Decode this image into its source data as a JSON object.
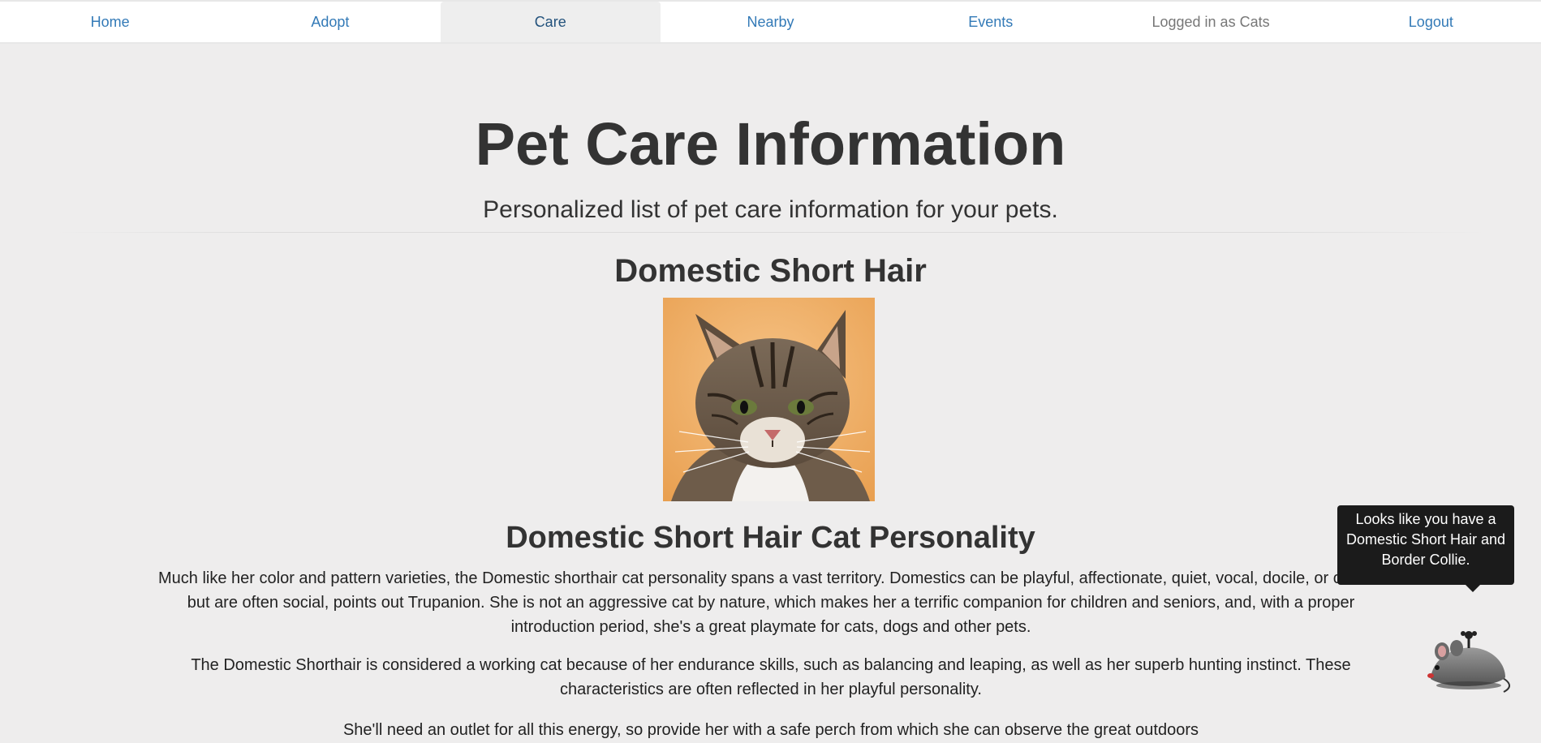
{
  "nav": {
    "home": "Home",
    "adopt": "Adopt",
    "care": "Care",
    "nearby": "Nearby",
    "events": "Events",
    "logged_in": "Logged in as Cats",
    "logout": "Logout"
  },
  "header": {
    "title": "Pet Care Information",
    "subtitle": "Personalized list of pet care information for your pets."
  },
  "breed": {
    "name": "Domestic Short Hair",
    "image_icon": "tabby-cat-photo"
  },
  "personality": {
    "heading": "Domestic Short Hair Cat Personality",
    "paragraphs": [
      "Much like her color and pattern varieties, the Domestic shorthair cat personality spans a vast territory. Domestics can be playful, affectionate, quiet, vocal, docile, or calm—but are often social, points out Trupanion. She is not an aggressive cat by nature, which makes her a terrific companion for children and seniors, and, with a proper introduction period, she's a great playmate for cats, dogs and other pets.",
      "The Domestic Shorthair is considered a working cat because of her endurance skills, such as balancing and leaping, as well as her superb hunting instinct. These characteristics are often reflected in her playful personality.",
      "She'll need an outlet for all this energy, so provide her with a safe perch from which she can observe the great outdoors"
    ]
  },
  "assistant": {
    "tooltip": "Looks like you have a Domestic Short Hair and Border Collie.",
    "icon": "robot-mouse-toy-icon"
  },
  "colors": {
    "link": "#337ab7",
    "background": "#eeeded",
    "tooltip_bg": "#1b1b1b"
  }
}
